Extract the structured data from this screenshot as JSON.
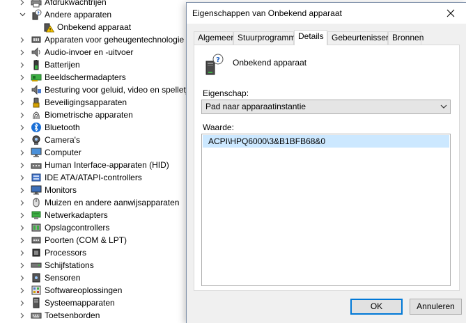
{
  "tree": {
    "items": [
      {
        "label": "Afdrukwachtrijen",
        "icon": "printer-icon",
        "expanded": false
      },
      {
        "label": "Andere apparaten",
        "icon": "unknown-device-icon",
        "expanded": true
      },
      {
        "label": "Onbekend apparaat",
        "icon": "warning-device-icon",
        "child": true
      },
      {
        "label": "Apparaten voor geheugentechnologie",
        "icon": "memory-device-icon",
        "expanded": false
      },
      {
        "label": "Audio-invoer en -uitvoer",
        "icon": "speaker-icon",
        "expanded": false
      },
      {
        "label": "Batterijen",
        "icon": "battery-icon",
        "expanded": false
      },
      {
        "label": "Beeldschermadapters",
        "icon": "display-adapter-icon",
        "expanded": false
      },
      {
        "label": "Besturing voor geluid, video en spelletjes",
        "icon": "sound-video-icon",
        "expanded": false
      },
      {
        "label": "Beveiligingsapparaten",
        "icon": "security-device-icon",
        "expanded": false
      },
      {
        "label": "Biometrische apparaten",
        "icon": "fingerprint-icon",
        "expanded": false
      },
      {
        "label": "Bluetooth",
        "icon": "bluetooth-icon",
        "expanded": false
      },
      {
        "label": "Camera's",
        "icon": "camera-icon",
        "expanded": false
      },
      {
        "label": "Computer",
        "icon": "computer-icon",
        "expanded": false
      },
      {
        "label": "Human Interface-apparaten (HID)",
        "icon": "hid-icon",
        "expanded": false
      },
      {
        "label": "IDE ATA/ATAPI-controllers",
        "icon": "ide-controller-icon",
        "expanded": false
      },
      {
        "label": "Monitors",
        "icon": "monitor-icon",
        "expanded": false
      },
      {
        "label": "Muizen en andere aanwijsapparaten",
        "icon": "mouse-icon",
        "expanded": false
      },
      {
        "label": "Netwerkadapters",
        "icon": "network-adapter-icon",
        "expanded": false
      },
      {
        "label": "Opslagcontrollers",
        "icon": "storage-controller-icon",
        "expanded": false
      },
      {
        "label": "Poorten (COM & LPT)",
        "icon": "port-icon",
        "expanded": false
      },
      {
        "label": "Processors",
        "icon": "processor-icon",
        "expanded": false
      },
      {
        "label": "Schijfstations",
        "icon": "disk-drive-icon",
        "expanded": false
      },
      {
        "label": "Sensoren",
        "icon": "sensor-icon",
        "expanded": false
      },
      {
        "label": "Softwareoplossingen",
        "icon": "software-component-icon",
        "expanded": false
      },
      {
        "label": "Systeemapparaten",
        "icon": "system-device-icon",
        "expanded": false
      },
      {
        "label": "Toetsenborden",
        "icon": "keyboard-icon",
        "expanded": false
      }
    ]
  },
  "dialog": {
    "title": "Eigenschappen van Onbekend apparaat",
    "tabs": [
      {
        "label": "Algemeen",
        "active": false
      },
      {
        "label": "Stuurprogramma",
        "active": false
      },
      {
        "label": "Details",
        "active": true
      },
      {
        "label": "Gebeurtenissen",
        "active": false
      },
      {
        "label": "Bronnen",
        "active": false
      }
    ],
    "device_name": "Onbekend apparaat",
    "property_label": "Eigenschap:",
    "property_value": "Pad naar apparaatinstantie",
    "value_label": "Waarde:",
    "value_item": "ACPI\\HPQ6000\\3&B1BFB68&0",
    "ok_label": "OK",
    "cancel_label": "Annuleren"
  },
  "colors": {
    "accent": "#0078d7",
    "selection": "#cce8ff",
    "dialog_bg": "#f0f0f0"
  }
}
